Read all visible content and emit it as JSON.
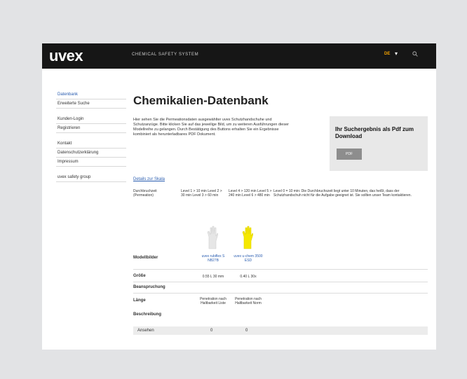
{
  "header": {
    "logo": "uvex",
    "site_title": "CHEMICAL SAFETY SYSTEM",
    "language": "DE",
    "language_arrow": "▾",
    "search_icon": "search-icon"
  },
  "sidebar": {
    "group1": [
      "Datenbank",
      "Erweiterte Suche"
    ],
    "group2": [
      "Kunden-Login",
      "Registrieren"
    ],
    "group3": [
      "Kontakt",
      "Datenschutzerklärung",
      "Impressum"
    ],
    "group4": [
      "uvex safety group"
    ]
  },
  "main": {
    "title": "Chemikalien-Datenbank",
    "intro": "Hier sehen Sie die Permeationsdaten ausgewählter uvex Schutzhandschuhe und Schutzanzüge. Bitte klicken Sie auf das jeweilige Bild, um zu weiteren Ausführungen dieser Modellreihe zu gelangen. Durch Bestätigung des Buttons erhalten Sie ein Ergebnisse kombiniert als herunterladbares PDF Dokument.",
    "promo": {
      "text": "Ihr Suchergebnis als Pdf zum Download",
      "button": "PDF"
    },
    "legend_link": "Details zur Skala",
    "legend": {
      "col1": "Durchbruchzeit (Permeation)",
      "col2": "Level 1 > 10 min Level 2 > 30 min Level 3 > 60 min",
      "col3": "Level 4 > 120 min Level 5 > 240 min Level 6 > 480 min",
      "col4": "Level 0 = 10 min: Die Durchbruchszeit liegt unter 10 Minuten, das heißt, dass der Schutzhandschuh nicht für die Aufgabe geeignet ist. Sie sollten unser Team kontaktieren."
    }
  },
  "table": {
    "labels": {
      "model": "Modellbilder",
      "size": "Größe",
      "material": "Beanspruchung",
      "length": "Länge",
      "description": "Beschreibung",
      "footer": "Ansehen"
    },
    "products": [
      {
        "name": "uvex rubiflex S NB27B",
        "size": "0.55 L 30 mm",
        "length": "Penetration nach Haltbarkeit Liste",
        "footer": "0",
        "color": "#e6e6e6"
      },
      {
        "name": "uvex u-chem 3500 ESD",
        "size": "0.40 L 30x",
        "length": "Penetration nach Haltbarkeit Norm",
        "footer": "0",
        "color": "#f5e800"
      }
    ]
  },
  "colors": {
    "link": "#2a5db0",
    "topbar": "#161616",
    "accent": "#f5a300"
  }
}
